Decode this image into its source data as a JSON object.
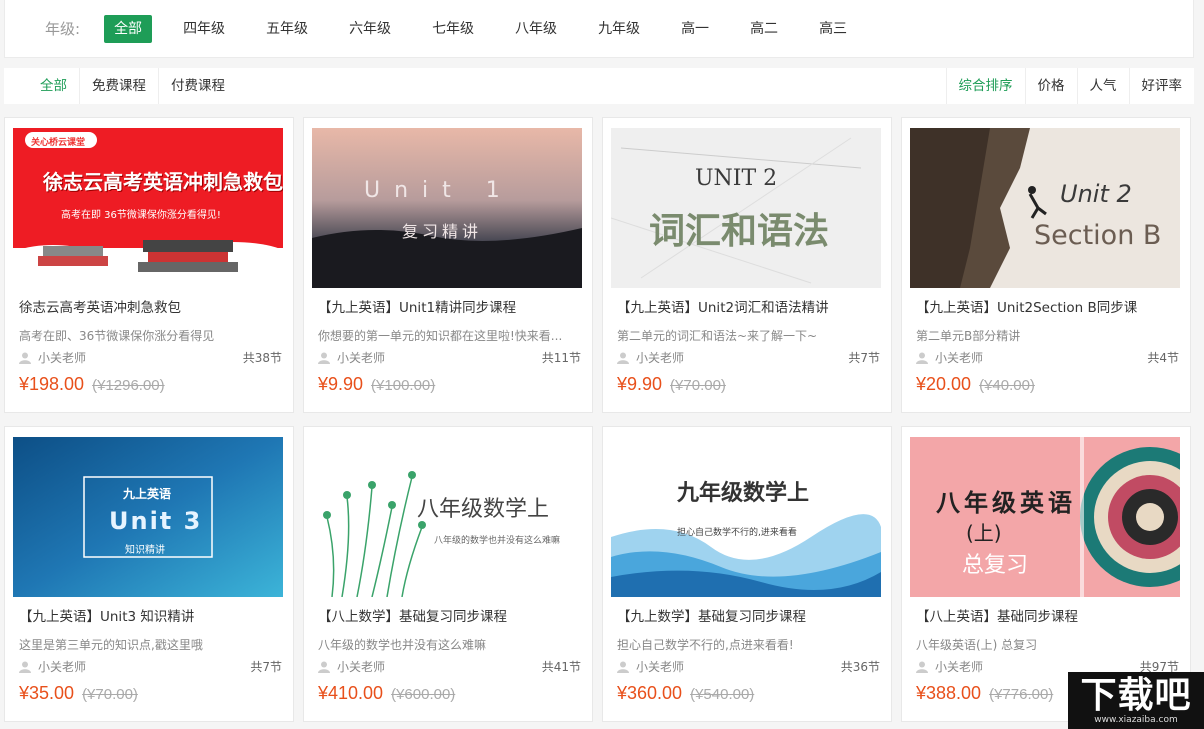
{
  "grade_bar": {
    "label": "年级:",
    "items": [
      "全部",
      "四年级",
      "五年级",
      "六年级",
      "七年级",
      "八年级",
      "九年级",
      "高一",
      "高二",
      "高三"
    ],
    "active_index": 0
  },
  "filter_bar": {
    "left": [
      "全部",
      "免费课程",
      "付费课程"
    ],
    "right": [
      "综合排序",
      "价格",
      "人气",
      "好评率"
    ]
  },
  "courses": [
    {
      "title": "徐志云高考英语冲刺急救包",
      "desc": "高考在即、36节微课保你涨分看得见",
      "teacher": "小关老师",
      "count": "共38节",
      "price": "¥198.00",
      "old_price": "(¥1296.00)",
      "thumb": {
        "line1": "徐志云高考英语冲刺急救包",
        "line2": "高考在即  36节微课保你涨分看得见!",
        "brand": "关心桥云课堂"
      }
    },
    {
      "title": "【九上英语】Unit1精讲同步课程",
      "desc": "你想要的第一单元的知识都在这里啦!快来看...",
      "teacher": "小关老师",
      "count": "共11节",
      "price": "¥9.90",
      "old_price": "(¥100.00)",
      "thumb": {
        "line1": "Unit 1",
        "line2": "复习精讲"
      }
    },
    {
      "title": "【九上英语】Unit2词汇和语法精讲",
      "desc": "第二单元的词汇和语法~来了解一下~",
      "teacher": "小关老师",
      "count": "共7节",
      "price": "¥9.90",
      "old_price": "(¥70.00)",
      "thumb": {
        "line1": "UNIT 2",
        "line2": "词汇和语法"
      }
    },
    {
      "title": "【九上英语】Unit2Section B同步课",
      "desc": "第二单元B部分精讲",
      "teacher": "小关老师",
      "count": "共4节",
      "price": "¥20.00",
      "old_price": "(¥40.00)",
      "thumb": {
        "line1": "Unit 2",
        "line2": "Section B"
      }
    },
    {
      "title": "【九上英语】Unit3 知识精讲",
      "desc": "这里是第三单元的知识点,戳这里哦",
      "teacher": "小关老师",
      "count": "共7节",
      "price": "¥35.00",
      "old_price": "(¥70.00)",
      "thumb": {
        "line0": "九上英语",
        "line1": "Unit 3",
        "line2": "知识精讲"
      }
    },
    {
      "title": "【八上数学】基础复习同步课程",
      "desc": "八年级的数学也并没有这么难嘛",
      "teacher": "小关老师",
      "count": "共41节",
      "price": "¥410.00",
      "old_price": "(¥600.00)",
      "thumb": {
        "line1": "八年级数学上",
        "line2": "八年级的数学也并没有这么难嘛"
      }
    },
    {
      "title": "【九上数学】基础复习同步课程",
      "desc": "担心自己数学不行的,点进来看看!",
      "teacher": "小关老师",
      "count": "共36节",
      "price": "¥360.00",
      "old_price": "(¥540.00)",
      "thumb": {
        "line1": "九年级数学上",
        "line2": "担心自己数学不行的,进来看看"
      }
    },
    {
      "title": "【八上英语】基础同步课程",
      "desc": "八年级英语(上) 总复习",
      "teacher": "小关老师",
      "count": "共97节",
      "price": "¥388.00",
      "old_price": "(¥776.00)",
      "thumb": {
        "line1": "八年级英语",
        "line2": "(上)",
        "line3": "总复习"
      }
    }
  ],
  "watermark": {
    "main": "下载吧",
    "sub": "www.xiazaiba.com"
  },
  "colors": {
    "accent": "#1e9d57",
    "price": "#e8501b"
  }
}
